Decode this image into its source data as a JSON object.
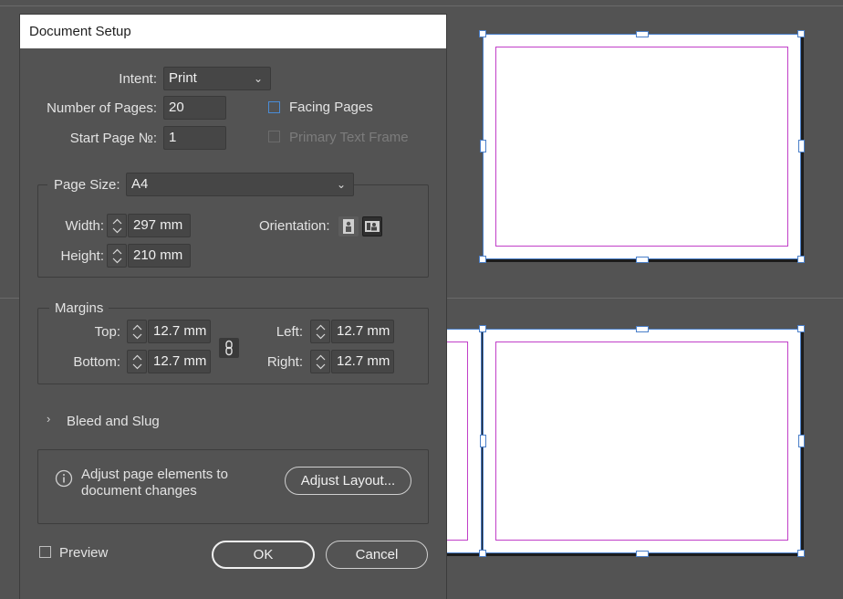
{
  "dialog": {
    "title": "Document Setup",
    "intent": {
      "label": "Intent:",
      "value": "Print"
    },
    "pages": {
      "label": "Number of Pages:",
      "value": "20"
    },
    "start_page": {
      "label": "Start Page №:",
      "value": "1"
    },
    "facing_pages": {
      "label": "Facing Pages",
      "checked": false
    },
    "primary_text_frame": {
      "label": "Primary Text Frame",
      "checked": false,
      "enabled": false
    },
    "page_size": {
      "label": "Page Size:",
      "value": "A4",
      "width_label": "Width:",
      "width": "297 mm",
      "height_label": "Height:",
      "height": "210 mm",
      "orientation_label": "Orientation:",
      "orientation": "landscape"
    },
    "margins": {
      "title": "Margins",
      "top_label": "Top:",
      "top": "12.7 mm",
      "bottom_label": "Bottom:",
      "bottom": "12.7 mm",
      "left_label": "Left:",
      "left": "12.7 mm",
      "right_label": "Right:",
      "right": "12.7 mm"
    },
    "bleed_slug": {
      "label": "Bleed and Slug",
      "expanded": false
    },
    "adjust": {
      "text_line1": "Adjust page elements to",
      "text_line2": "document changes",
      "button": "Adjust Layout..."
    },
    "preview": {
      "label": "Preview",
      "checked": false
    },
    "ok": "OK",
    "cancel": "Cancel"
  },
  "colors": {
    "canvas": "#535353",
    "margin_guide": "#c13fc8",
    "selection": "#4a7fc9",
    "checkbox_accent": "#4a8cd6"
  }
}
